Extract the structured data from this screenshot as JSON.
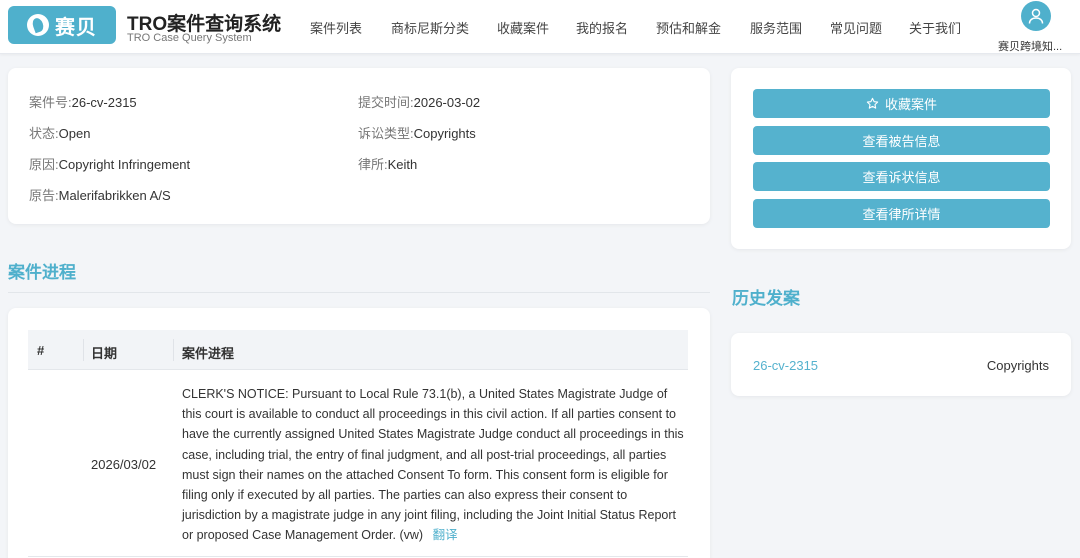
{
  "header": {
    "logo_text": "赛贝",
    "title": "TRO案件查询系统",
    "subtitle": "TRO Case Query System",
    "nav": [
      "案件列表",
      "商标尼斯分类",
      "收藏案件",
      "我的报名",
      "预估和解金",
      "服务范围",
      "常见问题",
      "关于我们"
    ],
    "user_name": "赛贝跨境知..."
  },
  "case_info": {
    "case_no_label": "案件号:",
    "case_no": "26-cv-2315",
    "submit_label": "提交时间:",
    "submit_date": "2026-03-02",
    "status_label": "状态:",
    "status": "Open",
    "type_label": "诉讼类型:",
    "type": "Copyrights",
    "cause_label": "原因:",
    "cause": "Copyright Infringement",
    "firm_label": "律所:",
    "firm": "Keith",
    "plaintiff_label": "原告:",
    "plaintiff": "Malerifabrikken A/S"
  },
  "actions": {
    "favorite": "收藏案件",
    "defendant": "查看被告信息",
    "complaint": "查看诉状信息",
    "firm_detail": "查看律所详情"
  },
  "progress": {
    "title": "案件进程",
    "columns": [
      "#",
      "日期",
      "案件进程"
    ],
    "rows": [
      {
        "date": "2026/03/02",
        "text": "CLERK'S NOTICE: Pursuant to Local Rule 73.1(b), a United States Magistrate Judge of this court is available to conduct all proceedings in this civil action. If all parties consent to have the currently assigned United States Magistrate Judge conduct all proceedings in this case, including trial, the entry of final judgment, and all post-trial proceedings, all parties must sign their names on the attached Consent To form. This consent form is eligible for filing only if executed by all parties. The parties can also express their consent to jurisdiction by a magistrate judge in any joint filing, including the Joint Initial Status Report or proposed Case Management Order. (vw)",
        "translate": "翻译"
      }
    ]
  },
  "history": {
    "title": "历史发案",
    "items": [
      {
        "case_no": "26-cv-2315",
        "type": "Copyrights"
      }
    ]
  },
  "colors": {
    "accent": "#4fb0cc",
    "button": "#55b2ce",
    "background": "#f3f5f8"
  }
}
